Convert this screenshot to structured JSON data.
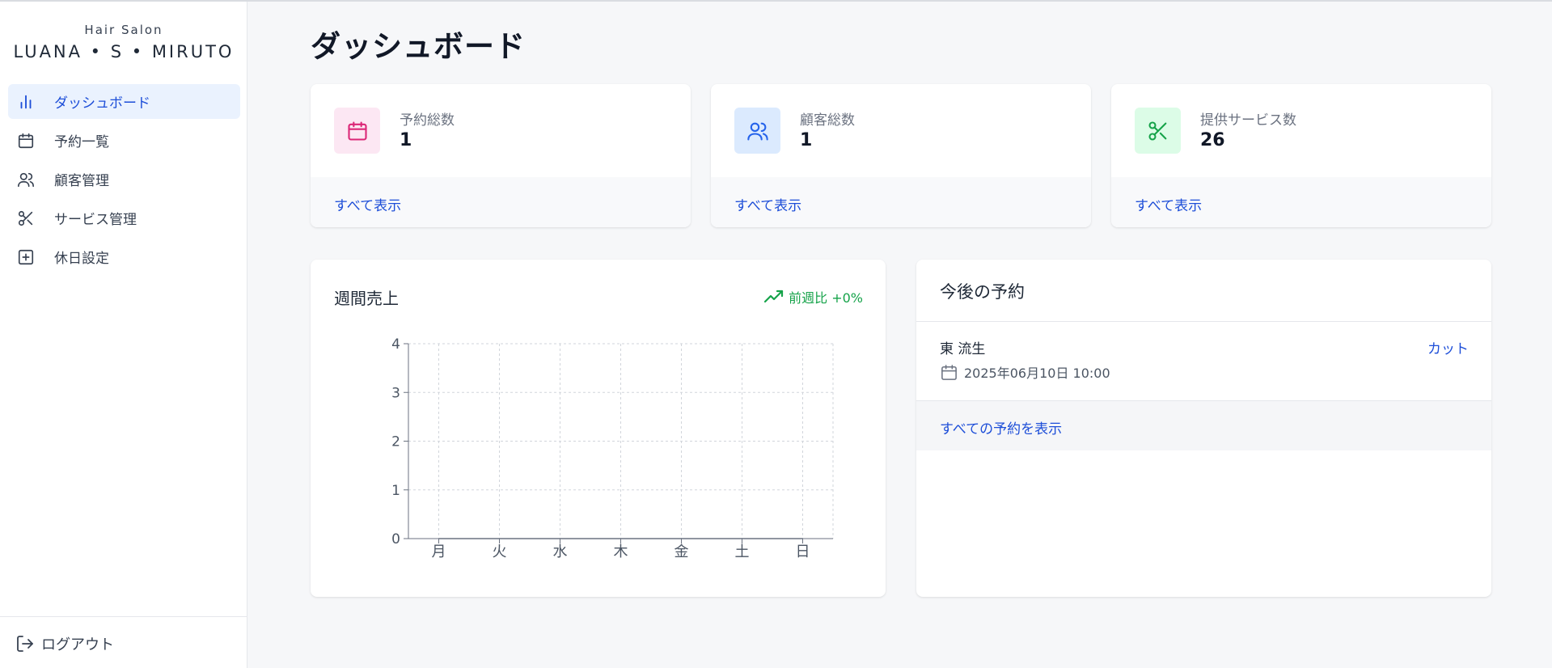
{
  "brand": {
    "subtitle": "Hair Salon",
    "name": "LUANA • S • MIRUTO"
  },
  "sidebar": {
    "items": [
      {
        "label": "ダッシュボード",
        "icon": "bar-chart-icon",
        "active": true
      },
      {
        "label": "予約一覧",
        "icon": "calendar-icon",
        "active": false
      },
      {
        "label": "顧客管理",
        "icon": "users-icon",
        "active": false
      },
      {
        "label": "サービス管理",
        "icon": "scissors-icon",
        "active": false
      },
      {
        "label": "休日設定",
        "icon": "plus-square-icon",
        "active": false
      }
    ],
    "logout_label": "ログアウト"
  },
  "page": {
    "title": "ダッシュボード"
  },
  "stats": [
    {
      "label": "予約総数",
      "value": "1",
      "link": "すべて表示",
      "icon": "calendar-icon",
      "color": "#db2777",
      "bg": "#fce7f3"
    },
    {
      "label": "顧客総数",
      "value": "1",
      "link": "すべて表示",
      "icon": "users-icon",
      "color": "#2563eb",
      "bg": "#dbeafe"
    },
    {
      "label": "提供サービス数",
      "value": "26",
      "link": "すべて表示",
      "icon": "scissors-icon",
      "color": "#16a34a",
      "bg": "#dcfce7"
    }
  ],
  "sales": {
    "title": "週間売上",
    "trend": "前週比 +0%",
    "trend_color": "#22c55e"
  },
  "chart_data": {
    "type": "line",
    "categories": [
      "月",
      "火",
      "水",
      "木",
      "金",
      "土",
      "日"
    ],
    "series": [
      {
        "values": [
          0,
          0,
          0,
          0,
          0,
          0,
          0
        ]
      }
    ],
    "yticks": [
      0,
      1,
      2,
      3,
      4
    ],
    "ylim": [
      0,
      4
    ],
    "grid": true,
    "title": "",
    "xlabel": "",
    "ylabel": ""
  },
  "upcoming": {
    "title": "今後の予約",
    "items": [
      {
        "name": "東 流生",
        "service": "カット",
        "datetime": "2025年06月10日 10:00"
      }
    ],
    "view_all": "すべての予約を表示"
  }
}
